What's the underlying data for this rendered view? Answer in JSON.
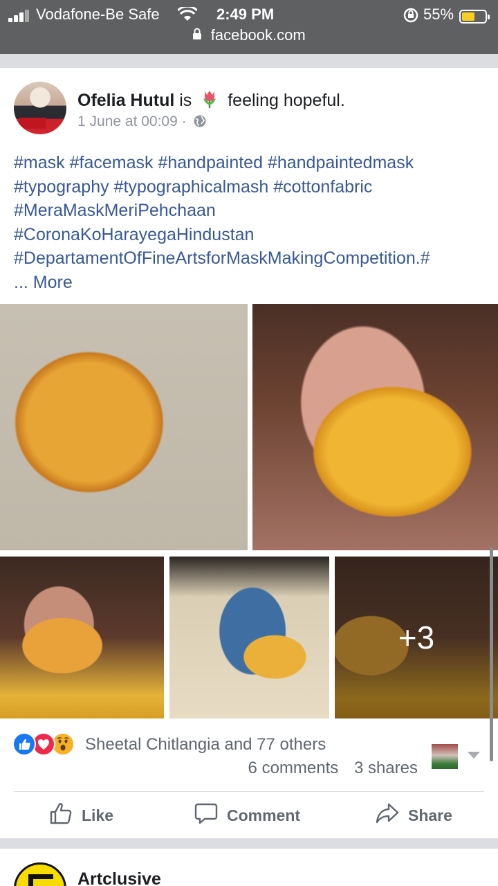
{
  "status_bar": {
    "carrier": "Vodafone-Be Safe",
    "time": "2:49 PM",
    "battery_percent": "55%",
    "battery_level": 0.55,
    "battery_color": "#f7cf23",
    "url": "facebook.com"
  },
  "post": {
    "author": "Ofelia Hutul",
    "is_text": "is",
    "feeling": "feeling hopeful.",
    "feeling_icon": "tulip-icon",
    "timestamp": "1 June at 00:09 ·",
    "audience_icon": "globe-icon",
    "hashtags": [
      "#mask",
      "#facemask",
      "#handpainted",
      "#handpaintedmask",
      "#typography",
      "#typographicalmash",
      "#cottonfabric",
      "#MeraMaskMeriPehchaan",
      "#CoronaKoHarayegaHindustan",
      "#DepartamentOfFineArtsforMaskMakingCompetition.#"
    ],
    "more_label": "... More",
    "extra_photos": "+3",
    "reactions": [
      "like",
      "love",
      "wow"
    ],
    "reactors_text": "Sheetal Chitlangia and 77 others",
    "comments_count": "6 comments",
    "shares_count": "3 shares",
    "actions": {
      "like": "Like",
      "comment": "Comment",
      "share": "Share"
    },
    "link_color": "#385898"
  },
  "next_post": {
    "author": "Artclusive"
  }
}
